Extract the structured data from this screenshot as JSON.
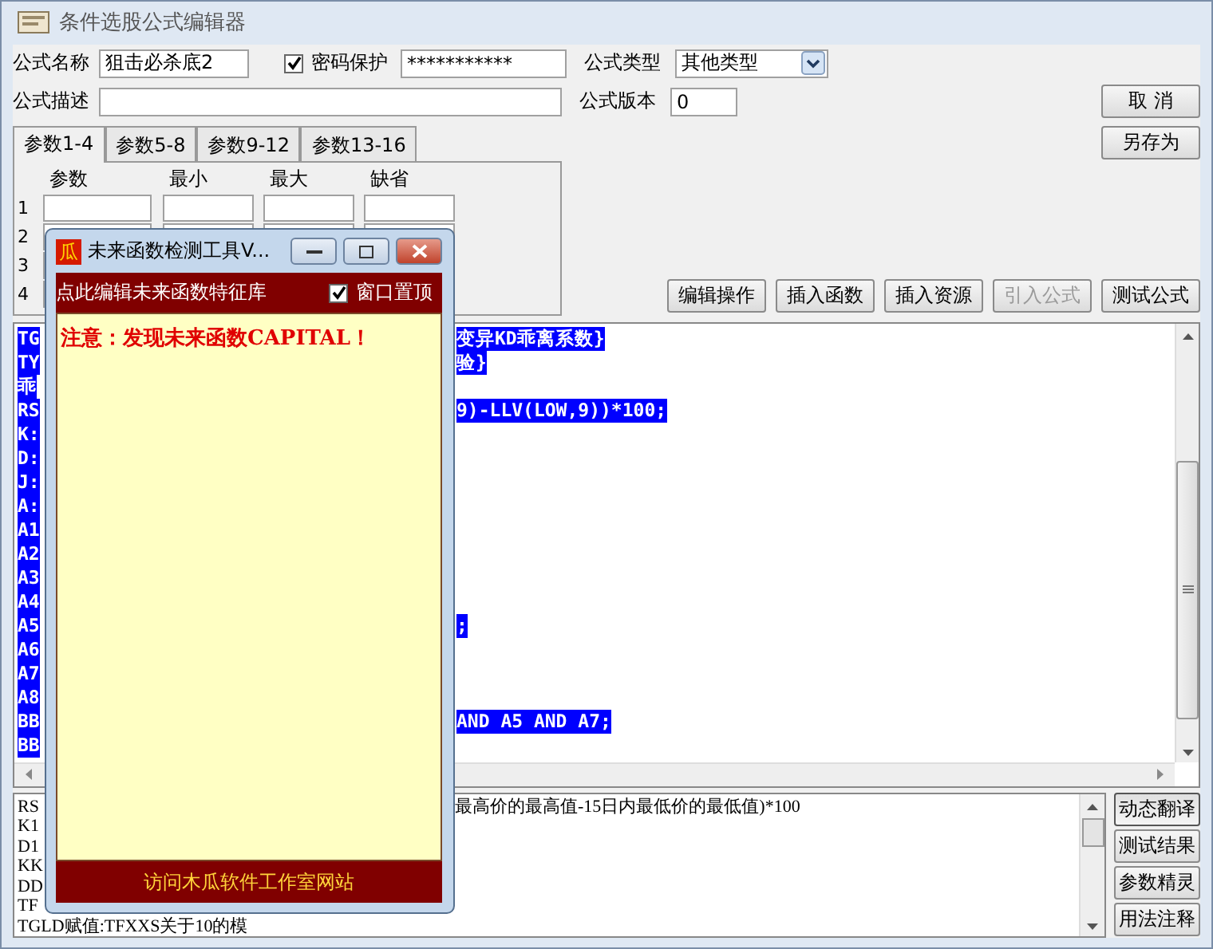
{
  "window": {
    "title": "条件选股公式编辑器"
  },
  "form": {
    "name_label": "公式名称",
    "name_value": "狙击必杀底2",
    "password": {
      "label": "密码保护",
      "checked": true,
      "value": "***********"
    },
    "type_label": "公式类型",
    "type_value": "其他类型",
    "desc_label": "公式描述",
    "version_label": "公式版本",
    "version_value": "0"
  },
  "side_top_buttons": [
    {
      "label": "取 消"
    },
    {
      "label": "另存为"
    }
  ],
  "tabs": [
    {
      "label": "参数1-4",
      "selected": true
    },
    {
      "label": "参数5-8",
      "selected": false
    },
    {
      "label": "参数9-12",
      "selected": false
    },
    {
      "label": "参数13-16",
      "selected": false
    }
  ],
  "params": {
    "columns": [
      "参数",
      "最小",
      "最大",
      "缺省"
    ],
    "rows": [
      "1",
      "2",
      "3",
      "4"
    ]
  },
  "toolbar": [
    {
      "label": "编辑操作",
      "disabled": false
    },
    {
      "label": "插入函数",
      "disabled": false
    },
    {
      "label": "插入资源",
      "disabled": false
    },
    {
      "label": "引入公式",
      "disabled": true
    },
    {
      "label": "测试公式",
      "disabled": false
    }
  ],
  "editor_lines": [
    {
      "left": "TG",
      "right": "变异KD乖离系数}"
    },
    {
      "left": "TY",
      "right": "验}"
    },
    {
      "left": "乖"
    },
    {
      "left": "RS",
      "right": "9)-LLV(LOW,9))*100;"
    },
    {
      "left": "K:"
    },
    {
      "left": "D:"
    },
    {
      "left": "J:"
    },
    {
      "left": "A:"
    },
    {
      "left": "A1"
    },
    {
      "left": "A2"
    },
    {
      "left": "A3"
    },
    {
      "left": "A4"
    },
    {
      "left": "A5",
      "right": ";"
    },
    {
      "left": "A6"
    },
    {
      "left": "A7"
    },
    {
      "left": "A8"
    },
    {
      "left": "BB",
      "right": "AND A5 AND A7;"
    },
    {
      "left": "BB"
    }
  ],
  "output_lines": [
    {
      "left": "RS",
      "right": "最高价的最高值-15日内最低价的最低值)*100"
    },
    {
      "left": "K1"
    },
    {
      "left": "D1"
    },
    {
      "left": "KK"
    },
    {
      "left": "DD"
    },
    {
      "left": "TF"
    },
    {
      "left": "TGLD赋值:TFXXS关于10的模"
    }
  ],
  "side_buttons": [
    {
      "label": "动态翻译",
      "pressed": true
    },
    {
      "label": "测试结果",
      "pressed": false
    },
    {
      "label": "参数精灵",
      "pressed": false
    },
    {
      "label": "用法注释",
      "pressed": false
    }
  ],
  "popup": {
    "title": "未来函数检测工具V...",
    "icon_char": "瓜",
    "header_link": "点此编辑未来函数特征库",
    "topmost": {
      "label": "窗口置顶",
      "checked": true
    },
    "message": "注意：发现未来函数CAPITAL！",
    "footer_link": "访问木瓜软件工作室网站"
  }
}
